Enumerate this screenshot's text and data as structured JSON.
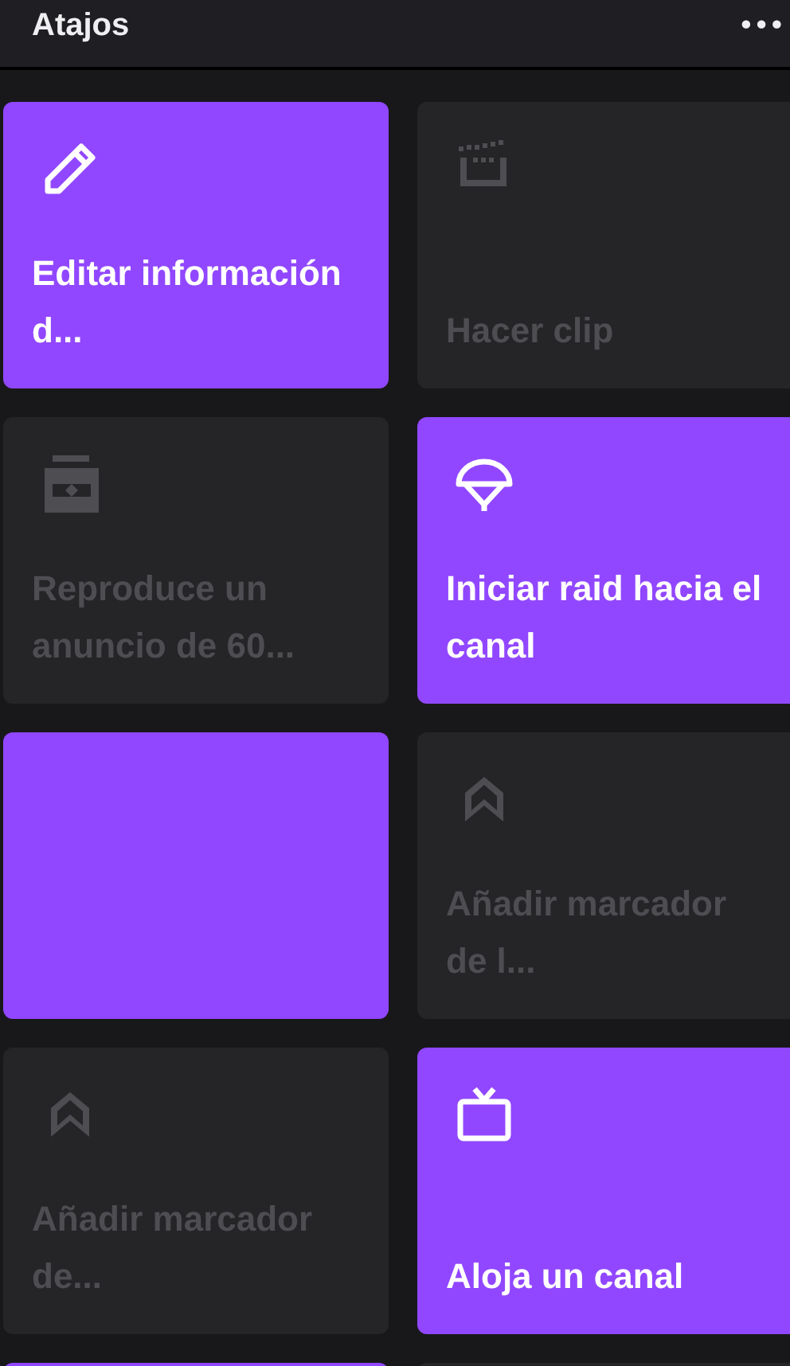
{
  "header": {
    "title": "Atajos",
    "menu": "•••"
  },
  "tiles": [
    {
      "kind": "pencil",
      "label": "Editar información d...",
      "enabled": true
    },
    {
      "kind": "clapper",
      "label": "Hacer clip",
      "enabled": false
    },
    {
      "kind": "ticket",
      "label": "Reproduce un anuncio de 60...",
      "enabled": false
    },
    {
      "kind": "parachute",
      "label": "Iniciar raid hacia el canal",
      "enabled": true
    },
    {
      "enabled": true
    },
    {
      "kind": "chevron",
      "label": "Añadir marcador de l...",
      "enabled": false
    },
    {
      "kind": "chevron",
      "label": "Añadir marcador de...",
      "enabled": false
    },
    {
      "kind": "tv",
      "label": "Aloja un canal",
      "enabled": true
    },
    {
      "enabled": true
    },
    {
      "enabled": false
    }
  ]
}
